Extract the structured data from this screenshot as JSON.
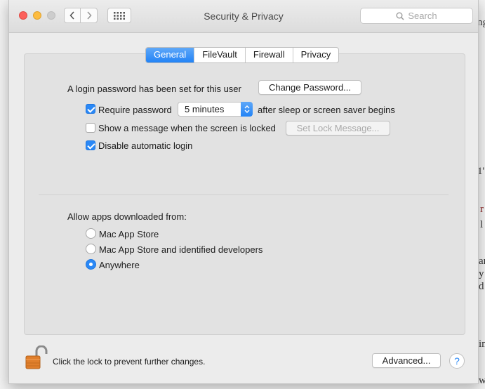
{
  "window": {
    "title": "Security & Privacy",
    "search_placeholder": "Search"
  },
  "tabs": [
    {
      "label": "General",
      "active": true
    },
    {
      "label": "FileVault",
      "active": false
    },
    {
      "label": "Firewall",
      "active": false
    },
    {
      "label": "Privacy",
      "active": false
    }
  ],
  "general": {
    "login_text": "A login password has been set for this user",
    "change_password_label": "Change Password...",
    "require_password": {
      "label": "Require password",
      "checked": true
    },
    "require_delay": "5 minutes",
    "require_suffix": "after sleep or screen saver begins",
    "show_message": {
      "label": "Show a message when the screen is locked",
      "checked": false
    },
    "set_lock_message_label": "Set Lock Message...",
    "disable_autologin": {
      "label": "Disable automatic login",
      "checked": true
    }
  },
  "allow_apps": {
    "heading": "Allow apps downloaded from:",
    "options": [
      {
        "label": "Mac App Store",
        "selected": false
      },
      {
        "label": "Mac App Store and identified developers",
        "selected": false
      },
      {
        "label": "Anywhere",
        "selected": true
      }
    ]
  },
  "footer": {
    "lock_text": "Click the lock to prevent further changes.",
    "advanced_label": "Advanced...",
    "help_label": "?"
  },
  "background_doc": {
    "fragments": [
      "ng",
      "1'",
      "r",
      "l",
      "ar",
      "y",
      "d",
      "in",
      "w"
    ]
  },
  "colors": {
    "accent": "#2a88f6",
    "close": "#fc605b",
    "minimize": "#fdbc40",
    "lock": "#e07f2c"
  }
}
